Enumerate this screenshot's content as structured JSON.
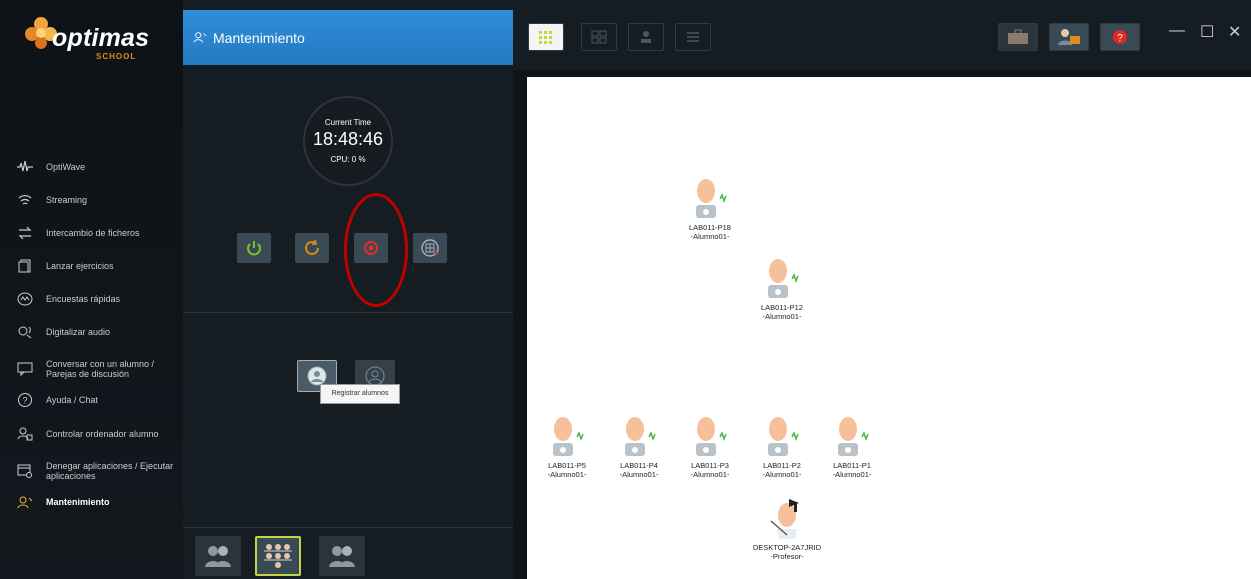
{
  "brand": {
    "name": "optimas",
    "sub": "SCHOOL"
  },
  "panel": {
    "title": "Mantenimiento"
  },
  "clock": {
    "label": "Current Time",
    "time": "18:48:46",
    "cpu": "CPU: 0 %"
  },
  "tooltip": "Registrar alumnos",
  "sidebar": {
    "items": [
      {
        "label": "OptiWave",
        "icon": "wave-icon"
      },
      {
        "label": "Streaming",
        "icon": "wifi-icon"
      },
      {
        "label": "Intercambio de ficheros",
        "icon": "exchange-icon"
      },
      {
        "label": "Lanzar ejercicios",
        "icon": "launch-icon"
      },
      {
        "label": "Encuestas rápidas",
        "icon": "poll-icon"
      },
      {
        "label": "Digitalizar audio",
        "icon": "audio-icon"
      },
      {
        "label": "Conversar con un alumno / Parejas de discusión",
        "icon": "chat-icon"
      },
      {
        "label": "Ayuda / Chat",
        "icon": "help-icon"
      },
      {
        "label": "Controlar ordenador alumno",
        "icon": "remote-control-icon"
      },
      {
        "label": "Denegar aplicaciones / Ejecutar aplicaciones",
        "icon": "deny-apps-icon"
      },
      {
        "label": "Mantenimiento",
        "icon": "maintenance-icon"
      }
    ]
  },
  "students": [
    {
      "name": "LAB011-P18",
      "user": "-Alumno01-"
    },
    {
      "name": "LAB011-P12",
      "user": "-Alumno01-"
    },
    {
      "name": "LAB011-P5",
      "user": "-Alumno01-"
    },
    {
      "name": "LAB011-P4",
      "user": "-Alumno01-"
    },
    {
      "name": "LAB011-P3",
      "user": "-Alumno01-"
    },
    {
      "name": "LAB011-P2",
      "user": "-Alumno01-"
    },
    {
      "name": "LAB011-P1",
      "user": "-Alumno01-"
    }
  ],
  "teacher": {
    "name": "DESKTOP-2A7JRID",
    "user": "-Profesor-"
  },
  "colors": {
    "accent": "#2a82cc",
    "highlight": "#c00000",
    "power": "#7ec12a",
    "restart": "#e08a1a"
  }
}
